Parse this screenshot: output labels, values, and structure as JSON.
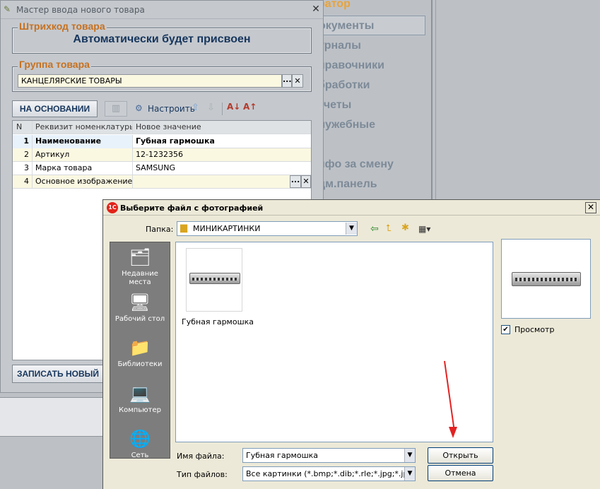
{
  "background_menu": {
    "items": [
      {
        "label": "ратор"
      },
      {
        "label": "окументы"
      },
      {
        "label": "урналы"
      },
      {
        "label": "правочники"
      },
      {
        "label": "бработки"
      },
      {
        "label": "тчеты"
      },
      {
        "label": "лужебные"
      },
      {
        "label": "нфо за смену"
      },
      {
        "label": "дм.панель"
      }
    ]
  },
  "wizard": {
    "title": "Мастер ввода нового товара",
    "barcode": {
      "legend": "Штрихкод товара",
      "value": "Автоматически будет присвоен"
    },
    "group": {
      "legend": "Группа товара",
      "value": "КАНЦЕЛЯРСКИЕ ТОВАРЫ",
      "select_glyph": "...",
      "clear_glyph": "✕"
    },
    "toolbar": {
      "based_on_label": "НА ОСНОВАНИИ",
      "configure_label": "Настроить"
    },
    "table": {
      "headers": [
        "N",
        "Реквизит номенклатуры",
        "Новое значение"
      ],
      "rows": [
        {
          "n": "1",
          "attr": "Наименование",
          "value": "Губная гармошка"
        },
        {
          "n": "2",
          "attr": "Артикул",
          "value": "12-1232356"
        },
        {
          "n": "3",
          "attr": "Марка товара",
          "value": "SAMSUNG"
        },
        {
          "n": "4",
          "attr": "Основное изображение",
          "value": ""
        }
      ]
    },
    "save_new_label": "ЗАПИСАТЬ НОВЫЙ"
  },
  "dialog": {
    "title": "Выберите файл с фотографией",
    "icon_text": "1C",
    "folder_label": "Папка:",
    "folder_value": "МИНИКАРТИНКИ",
    "places": [
      {
        "label": "Недавние места",
        "icon": "recent-places-icon"
      },
      {
        "label": "Рабочий стол",
        "icon": "desktop-icon"
      },
      {
        "label": "Библиотеки",
        "icon": "libraries-icon"
      },
      {
        "label": "Компьютер",
        "icon": "computer-icon"
      },
      {
        "label": "Сеть",
        "icon": "network-icon"
      }
    ],
    "files": [
      {
        "name": "Губная гармошка"
      }
    ],
    "preview_label": "Просмотр",
    "preview_checked": true,
    "filename_label": "Имя файла:",
    "filename_value": "Губная гармошка",
    "filetype_label": "Тип файлов:",
    "filetype_value": "Все картинки (*.bmp;*.dib;*.rle;*.jpg;*.jpeg;*.tif;*",
    "open_label": "Открыть",
    "cancel_label": "Отмена"
  },
  "colors": {
    "legend": "#c6711f",
    "barcode_text": "#17365d",
    "annotation_arrow": "#e32222"
  }
}
